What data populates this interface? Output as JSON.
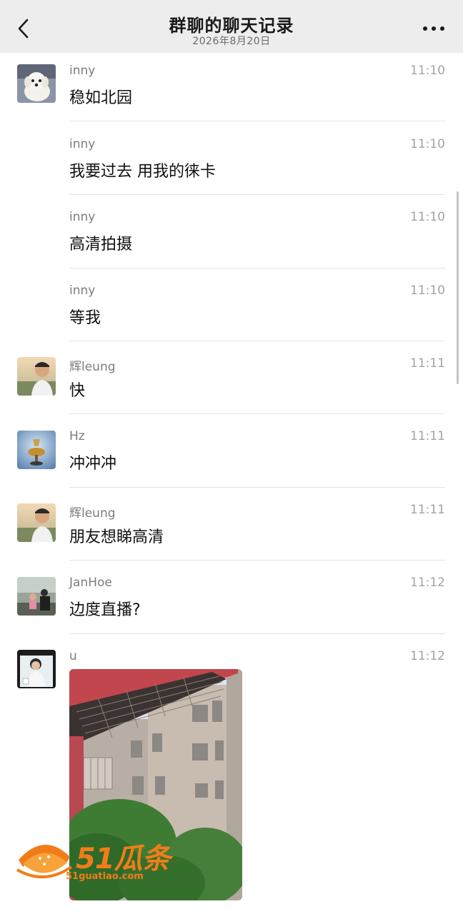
{
  "header": {
    "title": "群聊的聊天记录",
    "date": "2026年8月20日"
  },
  "messages": [
    {
      "sender": "inny",
      "time": "11:10",
      "text": "稳如北园",
      "avatar": "white-dog-avatar"
    },
    {
      "sender": "inny",
      "time": "11:10",
      "text": "我要过去 用我的徕卡"
    },
    {
      "sender": "inny",
      "time": "11:10",
      "text": "高清拍摄"
    },
    {
      "sender": "inny",
      "time": "11:10",
      "text": "等我"
    },
    {
      "sender": "辉leung",
      "time": "11:11",
      "text": "快",
      "avatar": "man-sunset-avatar"
    },
    {
      "sender": "Hz",
      "time": "11:11",
      "text": "冲冲冲",
      "avatar": "trophy-sky-avatar"
    },
    {
      "sender": "辉leung",
      "time": "11:11",
      "text": "朋友想睇高清",
      "avatar": "man-sunset-avatar"
    },
    {
      "sender": "JanHoe",
      "time": "11:12",
      "text": "边度直播?",
      "avatar": "people-outdoor-avatar"
    },
    {
      "sender": "u",
      "time": "11:12",
      "text": "",
      "avatar": "girl-photo-avatar",
      "image": "building-photo"
    }
  ],
  "watermark": {
    "logo_text": "51瓜条",
    "url": "51guatiao.com"
  },
  "colors": {
    "header_bg": "#ededed",
    "divider": "#e5e5e5",
    "watermark": "#f07d1a"
  },
  "icons": [
    "back-chevron-icon",
    "more-dots-icon"
  ]
}
